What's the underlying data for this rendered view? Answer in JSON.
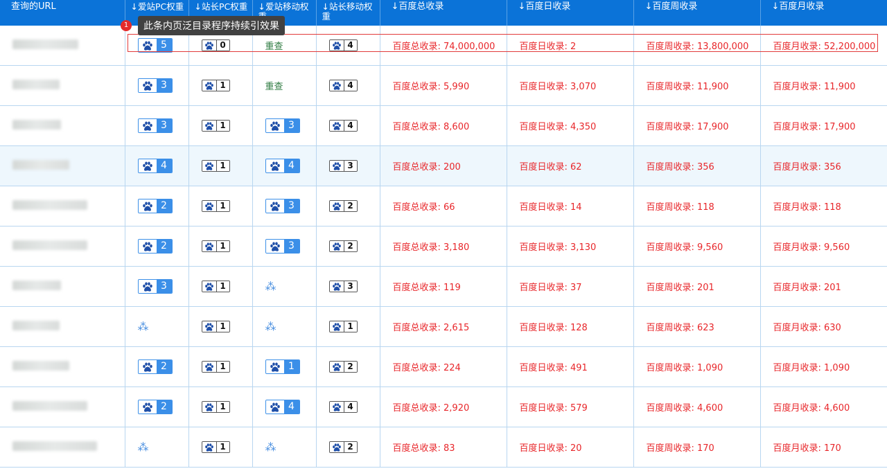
{
  "header": {
    "cols": [
      "查询的URL",
      "↓爱站PC权重",
      "↓站长PC权重",
      "↓爱站移动权重",
      "↓站长移动权重",
      "↓百度总收录",
      "↓百度日收录",
      "↓百度周收录",
      "↓百度月收录"
    ]
  },
  "tooltip": {
    "badge": "1",
    "text": "此条内页泛目录程序持续引效果"
  },
  "labels": {
    "total": "百度总收录: ",
    "day": "百度日收录: ",
    "week": "百度周收录: ",
    "month": "百度月收录: ",
    "recheck": "重查"
  },
  "icons": {
    "paw": "baidu-paw-icon",
    "loading": "loading-spinner-icon"
  },
  "colors": {
    "header_bg": "#0b73d8",
    "badge_blue": "#3b8fe8",
    "value_red": "#e8262a",
    "highlight_border": "#e23b3b"
  },
  "rows": [
    {
      "aizhan_pc": "5",
      "zz_pc": "0",
      "aizhan_m": "重查",
      "zz_m": "4",
      "total": "74,000,000",
      "day": "2",
      "week": "13,800,000",
      "month": "52,200,000"
    },
    {
      "aizhan_pc": "3",
      "zz_pc": "1",
      "aizhan_m": "重查",
      "zz_m": "4",
      "total": "5,990",
      "day": "3,070",
      "week": "11,900",
      "month": "11,900"
    },
    {
      "aizhan_pc": "3",
      "zz_pc": "1",
      "aizhan_m": "3",
      "zz_m": "4",
      "total": "8,600",
      "day": "4,350",
      "week": "17,900",
      "month": "17,900"
    },
    {
      "aizhan_pc": "4",
      "zz_pc": "1",
      "aizhan_m": "4",
      "zz_m": "3",
      "total": "200",
      "day": "62",
      "week": "356",
      "month": "356"
    },
    {
      "aizhan_pc": "2",
      "zz_pc": "1",
      "aizhan_m": "3",
      "zz_m": "2",
      "total": "66",
      "day": "14",
      "week": "118",
      "month": "118"
    },
    {
      "aizhan_pc": "2",
      "zz_pc": "1",
      "aizhan_m": "3",
      "zz_m": "2",
      "total": "3,180",
      "day": "3,130",
      "week": "9,560",
      "month": "9,560"
    },
    {
      "aizhan_pc": "3",
      "zz_pc": "1",
      "aizhan_m": "loading",
      "zz_m": "3",
      "total": "119",
      "day": "37",
      "week": "201",
      "month": "201"
    },
    {
      "aizhan_pc": "loading",
      "zz_pc": "1",
      "aizhan_m": "loading",
      "zz_m": "1",
      "total": "2,615",
      "day": "128",
      "week": "623",
      "month": "630"
    },
    {
      "aizhan_pc": "2",
      "zz_pc": "1",
      "aizhan_m": "1",
      "zz_m": "2",
      "total": "224",
      "day": "491",
      "week": "1,090",
      "month": "1,090"
    },
    {
      "aizhan_pc": "2",
      "zz_pc": "1",
      "aizhan_m": "4",
      "zz_m": "4",
      "total": "2,920",
      "day": "579",
      "week": "4,600",
      "month": "4,600"
    },
    {
      "aizhan_pc": "loading",
      "zz_pc": "1",
      "aizhan_m": "loading",
      "zz_m": "2",
      "total": "83",
      "day": "20",
      "week": "170",
      "month": "170"
    }
  ]
}
